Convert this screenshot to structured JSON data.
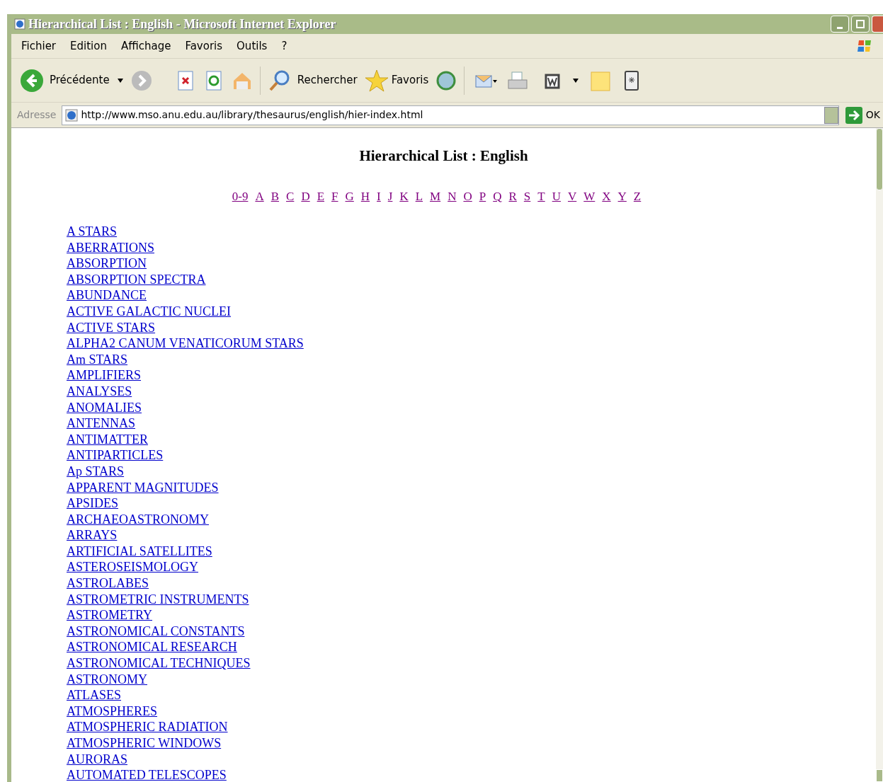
{
  "window": {
    "title": "Hierarchical List : English - Microsoft Internet Explorer"
  },
  "menu": [
    "Fichier",
    "Edition",
    "Affichage",
    "Favoris",
    "Outils",
    "?"
  ],
  "toolbar": {
    "back": "Précédente",
    "search": "Rechercher",
    "favorites": "Favoris"
  },
  "address": {
    "label": "Adresse",
    "url": "http://www.mso.anu.edu.au/library/thesaurus/english/hier-index.html",
    "go": "OK"
  },
  "page": {
    "heading": "Hierarchical List : English",
    "letters": [
      "0-9",
      "A",
      "B",
      "C",
      "D",
      "E",
      "F",
      "G",
      "H",
      "I",
      "J",
      "K",
      "L",
      "M",
      "N",
      "O",
      "P",
      "Q",
      "R",
      "S",
      "T",
      "U",
      "V",
      "W",
      "X",
      "Y",
      "Z"
    ],
    "terms": [
      "A STARS",
      "ABERRATIONS",
      "ABSORPTION",
      "ABSORPTION SPECTRA",
      "ABUNDANCE",
      "ACTIVE GALACTIC NUCLEI",
      "ACTIVE STARS",
      "ALPHA2 CANUM VENATICORUM STARS",
      "Am STARS",
      "AMPLIFIERS",
      "ANALYSES",
      "ANOMALIES",
      "ANTENNAS",
      "ANTIMATTER",
      "ANTIPARTICLES",
      "Ap STARS",
      "APPARENT MAGNITUDES",
      "APSIDES",
      "ARCHAEOASTRONOMY",
      "ARRAYS",
      "ARTIFICIAL SATELLITES",
      "ASTEROSEISMOLOGY",
      "ASTROLABES",
      "ASTROMETRIC INSTRUMENTS",
      "ASTROMETRY",
      "ASTRONOMICAL CONSTANTS",
      "ASTRONOMICAL RESEARCH",
      "ASTRONOMICAL TECHNIQUES",
      "ASTRONOMY",
      "ATLASES",
      "ATMOSPHERES",
      "ATMOSPHERIC RADIATION",
      "ATMOSPHERIC WINDOWS",
      "AURORAS",
      "AUTOMATED TELESCOPES"
    ]
  }
}
